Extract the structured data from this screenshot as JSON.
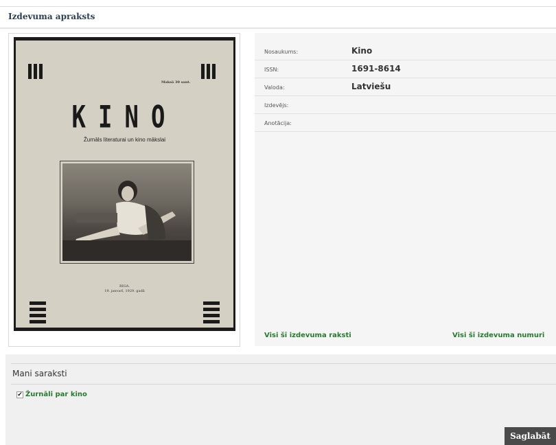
{
  "section": {
    "title": "Izdevuma apraksts"
  },
  "cover": {
    "price": "Maksā 30 sant.",
    "masthead": "KINO",
    "subtitle": "Žurnāls literaturai un kino mākslai",
    "place": "RIGA.",
    "date": "19. janvarī, 1929. gadā"
  },
  "details": {
    "rows": [
      {
        "label": "Nosaukums:",
        "value": "Kino"
      },
      {
        "label": "ISSN:",
        "value": "1691-8614"
      },
      {
        "label": "Valoda:",
        "value": "Latviešu"
      },
      {
        "label": "Izdevējs:",
        "value": ""
      },
      {
        "label": "Anotācija:",
        "value": ""
      }
    ],
    "link_articles": "Visi šī izdevuma raksti",
    "link_issues": "Visi šī izdevuma numuri"
  },
  "lists": {
    "title": "Mani saraksti",
    "items": [
      {
        "label": "Žurnāli par kino",
        "checked": true
      }
    ],
    "save_label": "Saglabāt"
  }
}
